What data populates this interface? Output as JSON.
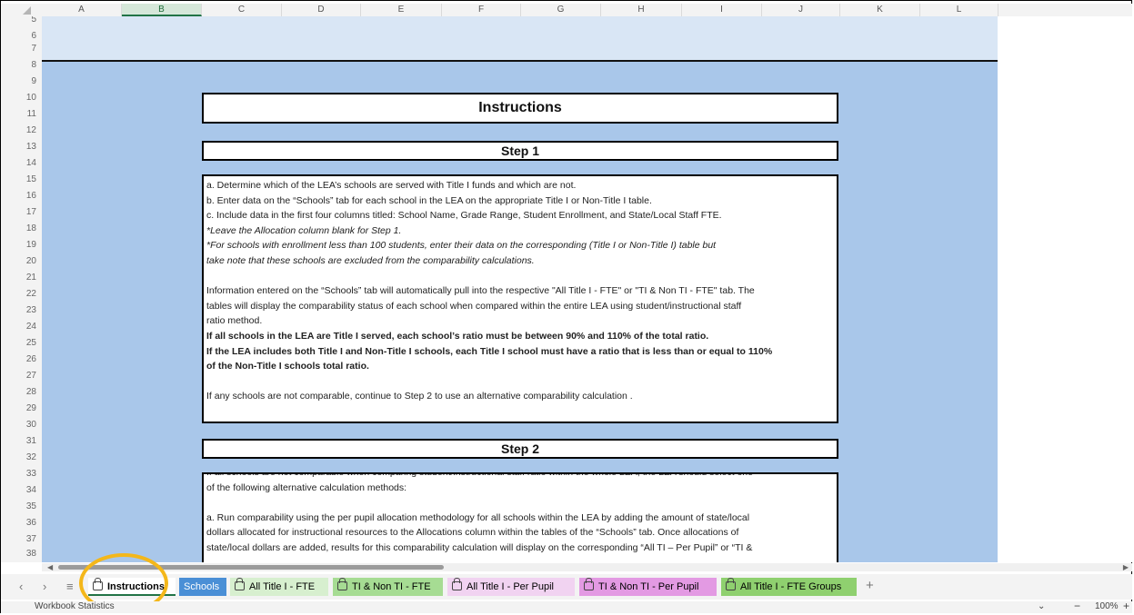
{
  "columns": [
    "A",
    "B",
    "C",
    "D",
    "E",
    "F",
    "G",
    "H",
    "I",
    "J",
    "K",
    "L"
  ],
  "selected_column": "B",
  "rows": [
    "5",
    "6",
    "7",
    "8",
    "9",
    "10",
    "11",
    "12",
    "13",
    "14",
    "15",
    "16",
    "17",
    "18",
    "19",
    "20",
    "21",
    "22",
    "23",
    "24",
    "25",
    "26",
    "27",
    "28",
    "29",
    "30",
    "31",
    "32",
    "33",
    "34",
    "35",
    "36",
    "37",
    "38"
  ],
  "instructions_title": "Instructions",
  "step1": {
    "title": "Step 1",
    "line_a": "a. Determine which of the LEA’s schools are served with Title I funds and which are not.",
    "line_b": "b. Enter data on the “Schools” tab for each school in the LEA on the appropriate Title I or Non-Title I table.",
    "line_c": "c. Include data in the first four columns titled: School Name, Grade Range, Student Enrollment, and State/Local Staff FTE.",
    "note1": "*Leave the Allocation column blank for Step 1.",
    "note2a": "*For schools with enrollment less than 100 students, enter their data on the corresponding (Title I or Non-Title I) table but",
    "note2b": "take note that these schools are excluded from the comparability calculations.",
    "info1": "Information entered on the “Schools” tab will automatically pull into the respective \"All Title I - FTE\" or \"TI & Non TI - FTE\" tab. The",
    "info2": "tables will display the comparability status of each school when compared within the entire LEA using student/instructional staff",
    "info3": "ratio method.",
    "bold1": "If all schools in the LEA are Title I served, each school’s ratio must be between 90% and 110% of the total ratio.",
    "bold2": "If the LEA includes both Title I and Non-Title I schools, each Title I school must have a ratio that is less than or equal to 110%",
    "bold3": "of the Non-Title I schools total ratio.",
    "final": "If any schools are not comparable, continue to Step 2 to use an alternative comparability calculation ."
  },
  "step2": {
    "title": "Step 2",
    "cut": "If all schools are not comparable when comparing student/instructional staff ratio within the whole LEA, the LEA should select one",
    "line1": "of the following alternative calculation methods:",
    "a1": "a. Run comparability using the per pupil allocation methodology for all schools within the LEA by adding the amount of state/local",
    "a2": "dollars allocated for instructional resources to the Allocations column within the tables of the “Schools” tab. Once allocations of",
    "a3": "state/local dollars are added, results for this comparability calculation will display on the corresponding “All TI – Per Pupil” or “TI &"
  },
  "tabs": [
    {
      "label": "Instructions",
      "locked": true,
      "bg": "#ffffff",
      "active": true
    },
    {
      "label": "Schools",
      "locked": false,
      "bg": "#4a8fd6",
      "active": false
    },
    {
      "label": "All Title I - FTE",
      "locked": true,
      "bg": "#d7efcf",
      "active": false
    },
    {
      "label": "TI & Non TI - FTE",
      "locked": true,
      "bg": "#a6dc93",
      "active": false
    },
    {
      "label": "All Title I - Per Pupil",
      "locked": true,
      "bg": "#f1d3f1",
      "active": false
    },
    {
      "label": "TI & Non TI - Per Pupil",
      "locked": true,
      "bg": "#e39ae3",
      "active": false
    },
    {
      "label": "All Title I - FTE Groups",
      "locked": true,
      "bg": "#8fd06f",
      "active": false
    }
  ],
  "status": {
    "left": "Workbook Statistics",
    "zoom": "100%"
  },
  "highlight_color": "#f4b71a"
}
